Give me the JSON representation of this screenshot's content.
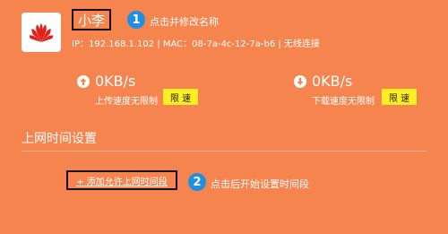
{
  "device": {
    "name": "小李",
    "info": "IP：192.168.1.102 | MAC：08-7a-4c-12-7a-b6 | 无线连接",
    "logo_icon": "huawei-logo-icon"
  },
  "annotations": {
    "step1_number": "1",
    "step1_text": "点击并修改名称",
    "step2_number": "2",
    "step2_text": "点击后开始设置时间段"
  },
  "upload": {
    "icon": "arrow-up-circle-icon",
    "value": "0KB/s",
    "caption": "上传速度无限制",
    "limit_label": "限 速"
  },
  "download": {
    "icon": "arrow-down-circle-icon",
    "value": "0KB/s",
    "caption": "下载速度无限制",
    "limit_label": "限 速"
  },
  "schedule": {
    "title": "上网时间设置",
    "add_link": "+ 添加允许上网时间段"
  },
  "colors": {
    "background": "#f6844f",
    "badge": "#1f8fe6",
    "limit_button": "#ffee22",
    "logo_red": "#e0201b"
  }
}
